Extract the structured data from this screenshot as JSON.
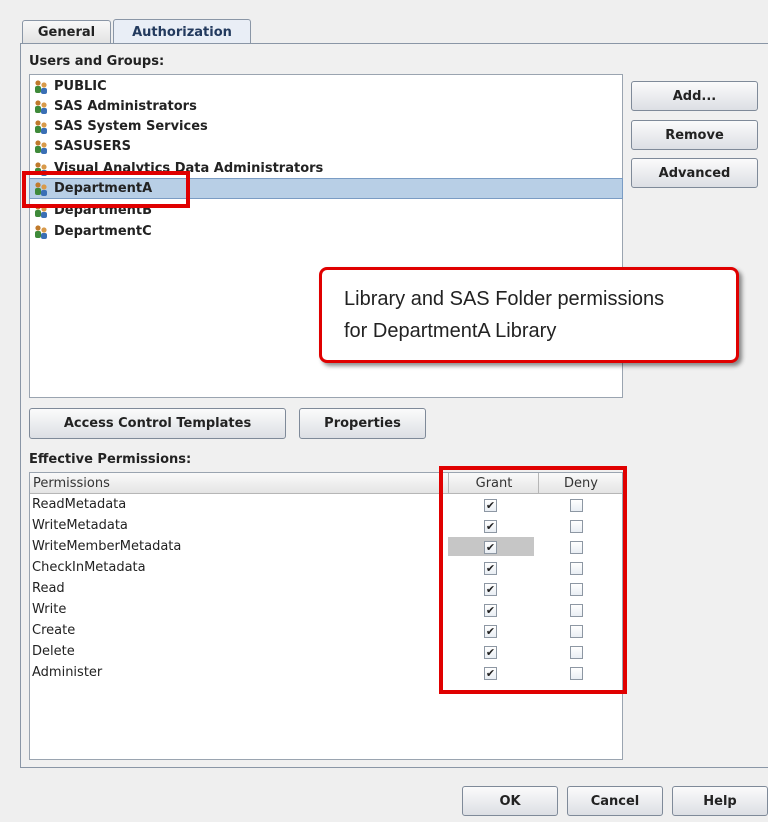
{
  "tabs": [
    {
      "label": "General",
      "active": false
    },
    {
      "label": "Authorization",
      "active": true
    }
  ],
  "users_groups": {
    "label": "Users and Groups:",
    "items": [
      {
        "label": "PUBLIC",
        "icon": "user-group-icon"
      },
      {
        "label": "SAS Administrators",
        "icon": "user-group-icon"
      },
      {
        "label": "SAS System Services",
        "icon": "user-group-icon"
      },
      {
        "label": "SASUSERS",
        "icon": "user-group-icon"
      },
      {
        "label": "Visual Analytics Data Administrators",
        "icon": "user-group-icon"
      },
      {
        "label": "DepartmentA",
        "icon": "user-group-icon",
        "selected": true
      },
      {
        "label": "DepartmentB",
        "icon": "user-group-icon"
      },
      {
        "label": "DepartmentC",
        "icon": "user-group-icon"
      }
    ]
  },
  "side_buttons": {
    "add": "Add...",
    "remove": "Remove",
    "advanced": "Advanced"
  },
  "mid_buttons": {
    "act": "Access Control Templates",
    "properties": "Properties"
  },
  "effective": {
    "label": "Effective Permissions:",
    "columns": [
      "Permissions",
      "Grant",
      "Deny"
    ],
    "rows": [
      {
        "name": "ReadMetadata",
        "grant": true,
        "deny": false
      },
      {
        "name": "WriteMetadata",
        "grant": true,
        "deny": false
      },
      {
        "name": "WriteMemberMetadata",
        "grant": true,
        "deny": false,
        "highlighted": true
      },
      {
        "name": "CheckInMetadata",
        "grant": true,
        "deny": false
      },
      {
        "name": "Read",
        "grant": true,
        "deny": false
      },
      {
        "name": "Write",
        "grant": true,
        "deny": false
      },
      {
        "name": "Create",
        "grant": true,
        "deny": false
      },
      {
        "name": "Delete",
        "grant": true,
        "deny": false
      },
      {
        "name": "Administer",
        "grant": true,
        "deny": false
      }
    ]
  },
  "bottom_buttons": {
    "ok": "OK",
    "cancel": "Cancel",
    "help": "Help"
  },
  "callout": {
    "line1": "Library and SAS Folder permissions",
    "line2": "for DepartmentA Library"
  },
  "check_glyph": "✔",
  "colors": {
    "annotation_red": "#e00000",
    "selection": "#b8cfe6"
  }
}
